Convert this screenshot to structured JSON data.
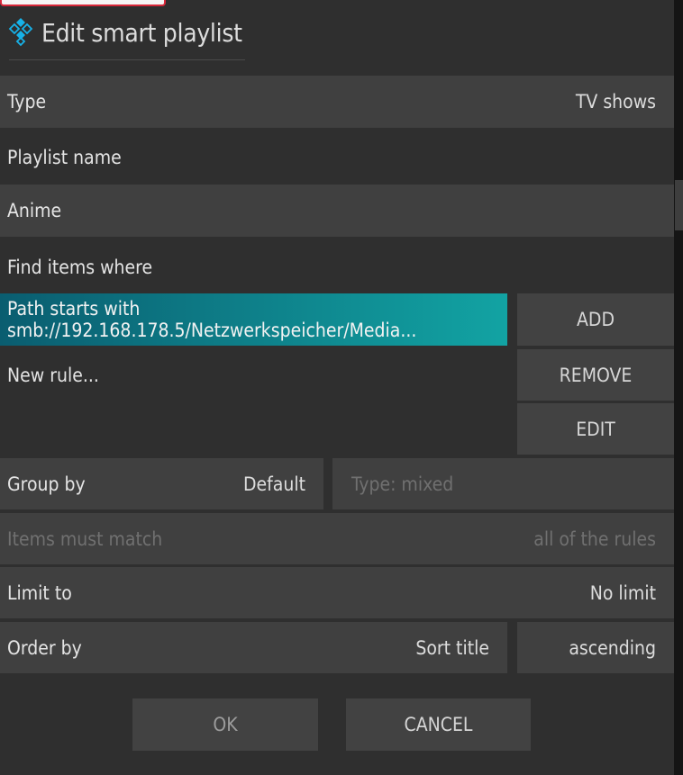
{
  "dialog": {
    "title": "Edit smart playlist",
    "type": {
      "label": "Type",
      "value": "TV shows"
    },
    "playlist_name": {
      "label": "Playlist name",
      "value": "Anime"
    },
    "find_items": {
      "label": "Find items where"
    },
    "rules": [
      "Path starts with smb://192.168.178.5/Netzwerkspeicher/Media...",
      "New rule..."
    ],
    "rule_buttons": {
      "add": "ADD",
      "remove": "REMOVE",
      "edit": "EDIT"
    },
    "group_by": {
      "label": "Group by",
      "value": "Default"
    },
    "group_type": "Type: mixed",
    "items_must_match": {
      "label": "Items must match",
      "value": "all of the rules"
    },
    "limit_to": {
      "label": "Limit to",
      "value": "No limit"
    },
    "order_by": {
      "label": "Order by",
      "value": "Sort title",
      "direction": "ascending"
    },
    "actions": {
      "ok": "OK",
      "cancel": "CANCEL"
    }
  },
  "colors": {
    "background": "#2f2f2f",
    "row": "#404040",
    "focus_start": "#0a5d70",
    "focus_end": "#12a3a3",
    "disabled_text": "#707070",
    "logo_accent": "#17b2e8"
  },
  "icons": {
    "logo": "kodi-logo-icon"
  }
}
